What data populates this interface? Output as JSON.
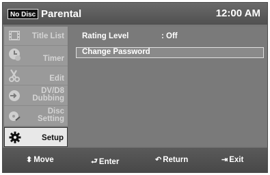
{
  "header": {
    "disc_badge": "No Disc",
    "title": "Parental",
    "time": "12:00 AM"
  },
  "sidebar": {
    "items": [
      {
        "label": "Title List",
        "icon": "film-icon",
        "active": false
      },
      {
        "label": "Timer",
        "icon": "timer-icon",
        "active": false
      },
      {
        "label": "Edit",
        "icon": "scissors-icon",
        "active": false
      },
      {
        "label_line1": "DV/D8",
        "label_line2": "Dubbing",
        "icon": "dubbing-icon",
        "active": false
      },
      {
        "label_line1": "Disc",
        "label_line2": "Setting",
        "icon": "disc-icon",
        "active": false
      },
      {
        "label": "Setup",
        "icon": "gear-icon",
        "active": true
      }
    ]
  },
  "main": {
    "rating_label": "Rating Level",
    "rating_value": ": Off",
    "change_password_label": "Change Password"
  },
  "footer": {
    "move": "Move",
    "enter": "Enter",
    "return": "Return",
    "exit": "Exit"
  }
}
